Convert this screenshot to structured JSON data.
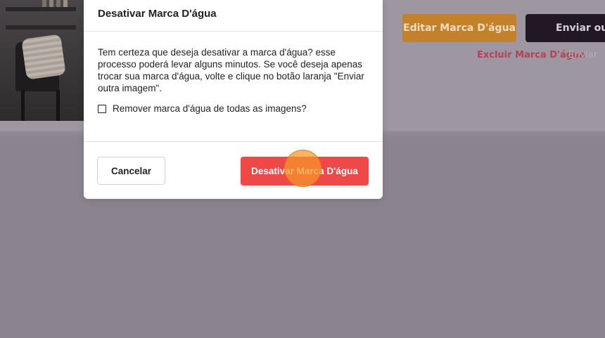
{
  "background": {
    "edit_button": "Editar Marca D'água",
    "send_button": "Enviar outra",
    "delete_link": "Excluir Marca D'água",
    "faded_link": "Enviar"
  },
  "modal": {
    "title": "Desativar Marca D'água",
    "message": "Tem certeza que deseja desativar a marca d'água? esse processo poderá levar alguns minutos. Se você deseja apenas trocar sua marca d'água, volte e clique no botão laranja \"Enviar outra imagem\".",
    "checkbox_label": "Remover marca d'água de todas as imagens?",
    "checkbox_checked": false,
    "cancel_label": "Cancelar",
    "confirm_label": "Desativar Marca D'água"
  },
  "colors": {
    "confirm_button": "#ef4848",
    "edit_button": "#c3812b",
    "send_button": "#211824",
    "click_marker": "#f59628"
  }
}
